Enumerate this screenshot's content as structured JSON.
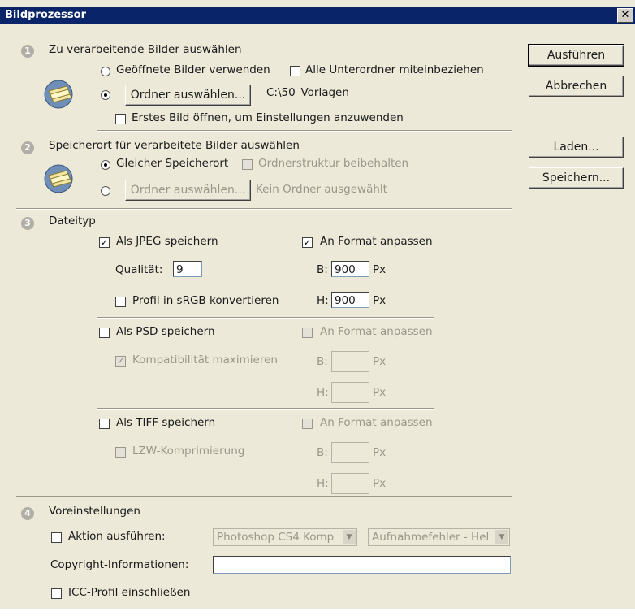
{
  "window": {
    "title": "Bildprozessor",
    "close": "✕"
  },
  "section1": {
    "number": "1",
    "heading": "Zu verarbeitende Bilder auswählen",
    "radio_open": "Geöffnete Bilder verwenden",
    "check_subfolders": "Alle Unterordner miteinbeziehen",
    "folder_button": "Ordner auswählen...",
    "folder_path": "C:\\50_Vorlagen",
    "check_first_image": "Erstes Bild öffnen, um Einstellungen anzuwenden"
  },
  "section2": {
    "number": "2",
    "heading": "Speicherort für verarbeitete Bilder auswählen",
    "radio_same": "Gleicher Speicherort",
    "check_keep_structure": "Ordnerstruktur beibehalten",
    "folder_button": "Ordner auswählen...",
    "no_folder": "Kein Ordner ausgewählt"
  },
  "section3": {
    "number": "3",
    "heading": "Dateityp",
    "jpeg": {
      "save": "Als JPEG speichern",
      "fit": "An Format anpassen",
      "quality_label": "Qualität:",
      "quality": "9",
      "w_label": "B:",
      "w": "900",
      "h_label": "H:",
      "h": "900",
      "unit": "Px",
      "srgb": "Profil in sRGB konvertieren"
    },
    "psd": {
      "save": "Als PSD speichern",
      "fit": "An Format anpassen",
      "compat": "Kompatibilität maximieren",
      "w_label": "B:",
      "h_label": "H:",
      "unit": "Px"
    },
    "tiff": {
      "save": "Als TIFF speichern",
      "fit": "An Format anpassen",
      "lzw": "LZW-Komprimierung",
      "w_label": "B:",
      "h_label": "H:",
      "unit": "Px"
    }
  },
  "section4": {
    "number": "4",
    "heading": "Voreinstellungen",
    "run_action": "Aktion ausführen:",
    "action_set": "Photoshop CS4 Komp",
    "action": "Aufnahmefehler - Hel",
    "copyright_label": "Copyright-Informationen:",
    "copyright": "",
    "icc": "ICC-Profil einschließen"
  },
  "buttons": {
    "run": "Ausführen",
    "cancel": "Abbrechen",
    "load": "Laden...",
    "save": "Speichern..."
  },
  "colors": {
    "titlebar": "#0a246a",
    "dialog": "#ece9d8"
  }
}
